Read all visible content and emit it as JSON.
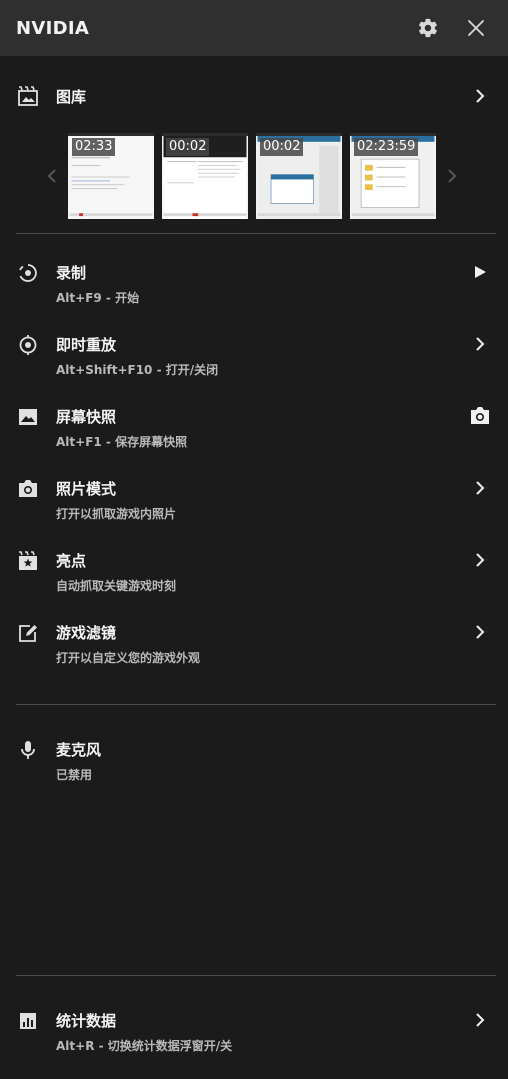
{
  "header": {
    "title": "NVIDIA",
    "settings_icon": "gear-icon",
    "close_icon": "close-icon"
  },
  "gallery": {
    "title": "图库",
    "icon": "gallery-film-icon",
    "thumbnails": [
      {
        "duration": "02:33"
      },
      {
        "duration": "00:02"
      },
      {
        "duration": "00:02"
      },
      {
        "duration": "02:23:59"
      }
    ]
  },
  "features": [
    {
      "title": "录制",
      "subtitle": "Alt+F9 - 开始",
      "icon": "record-icon",
      "action": "play-icon"
    },
    {
      "title": "即时重放",
      "subtitle": "Alt+Shift+F10 - 打开/关闭",
      "icon": "instant-replay-icon",
      "action": "chevron-right-icon"
    },
    {
      "title": "屏幕快照",
      "subtitle": "Alt+F1 - 保存屏幕快照",
      "icon": "image-icon",
      "action": "camera-icon"
    },
    {
      "title": "照片模式",
      "subtitle": "打开以抓取游戏内照片",
      "icon": "camera-icon",
      "action": "chevron-right-icon"
    },
    {
      "title": "亮点",
      "subtitle": "自动抓取关键游戏时刻",
      "icon": "highlights-star-icon",
      "action": "chevron-right-icon"
    },
    {
      "title": "游戏滤镜",
      "subtitle": "打开以自定义您的游戏外观",
      "icon": "filter-edit-icon",
      "action": "chevron-right-icon"
    }
  ],
  "microphone": {
    "title": "麦克风",
    "subtitle": "已禁用",
    "icon": "microphone-icon"
  },
  "stats": {
    "title": "统计数据",
    "subtitle": "Alt+R - 切换统计数据浮窗开/关",
    "icon": "stats-chart-icon",
    "action": "chevron-right-icon"
  }
}
